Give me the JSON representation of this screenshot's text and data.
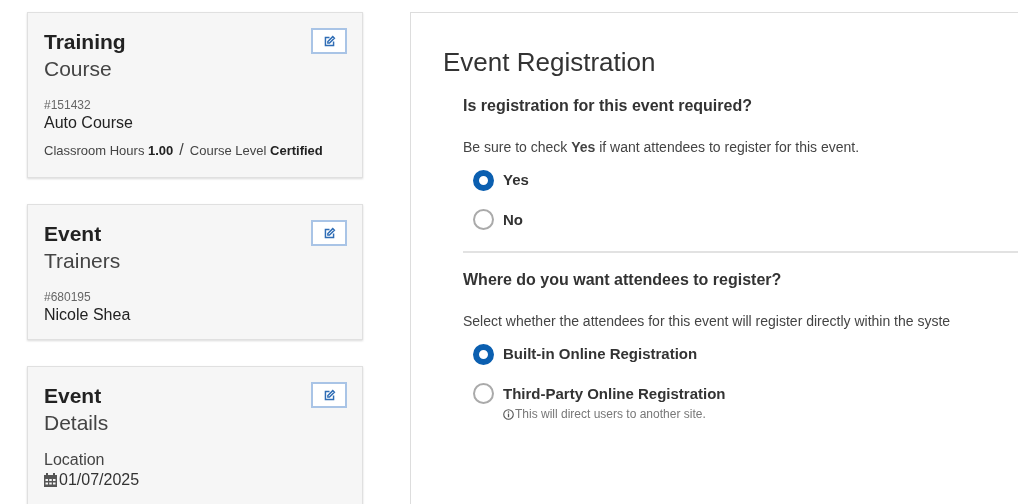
{
  "cards": [
    {
      "kind": "course",
      "title": "Training",
      "subtitle": "Course",
      "number": "#151432",
      "name": "Auto Course",
      "meta": [
        {
          "label": "Classroom Hours",
          "value": "1.00"
        },
        {
          "label": "Course Level",
          "value": "Certified"
        }
      ],
      "separator": "/"
    },
    {
      "kind": "trainers",
      "title": "Event",
      "subtitle": "Trainers",
      "number": "#680195",
      "name": "Nicole Shea"
    },
    {
      "kind": "details",
      "title": "Event",
      "subtitle": "Details",
      "location_label": "Location",
      "date": "01/07/2025"
    }
  ],
  "registration": {
    "title": "Event Registration",
    "sections": [
      {
        "question": "Is registration for this event required?",
        "description": "Be sure to check **Yes** if want attendees to register for this event.",
        "options": [
          {
            "label": "Yes",
            "selected": true
          },
          {
            "label": "No",
            "selected": false
          }
        ]
      },
      {
        "question": "Where do you want attendees to register?",
        "description": "Select whether the attendees for this event will register directly within the syste",
        "options": [
          {
            "label": "Built-in Online Registration",
            "selected": true
          },
          {
            "label": "Third-Party Online Registration",
            "selected": false,
            "hint": "This will direct users to another site."
          }
        ]
      }
    ]
  }
}
